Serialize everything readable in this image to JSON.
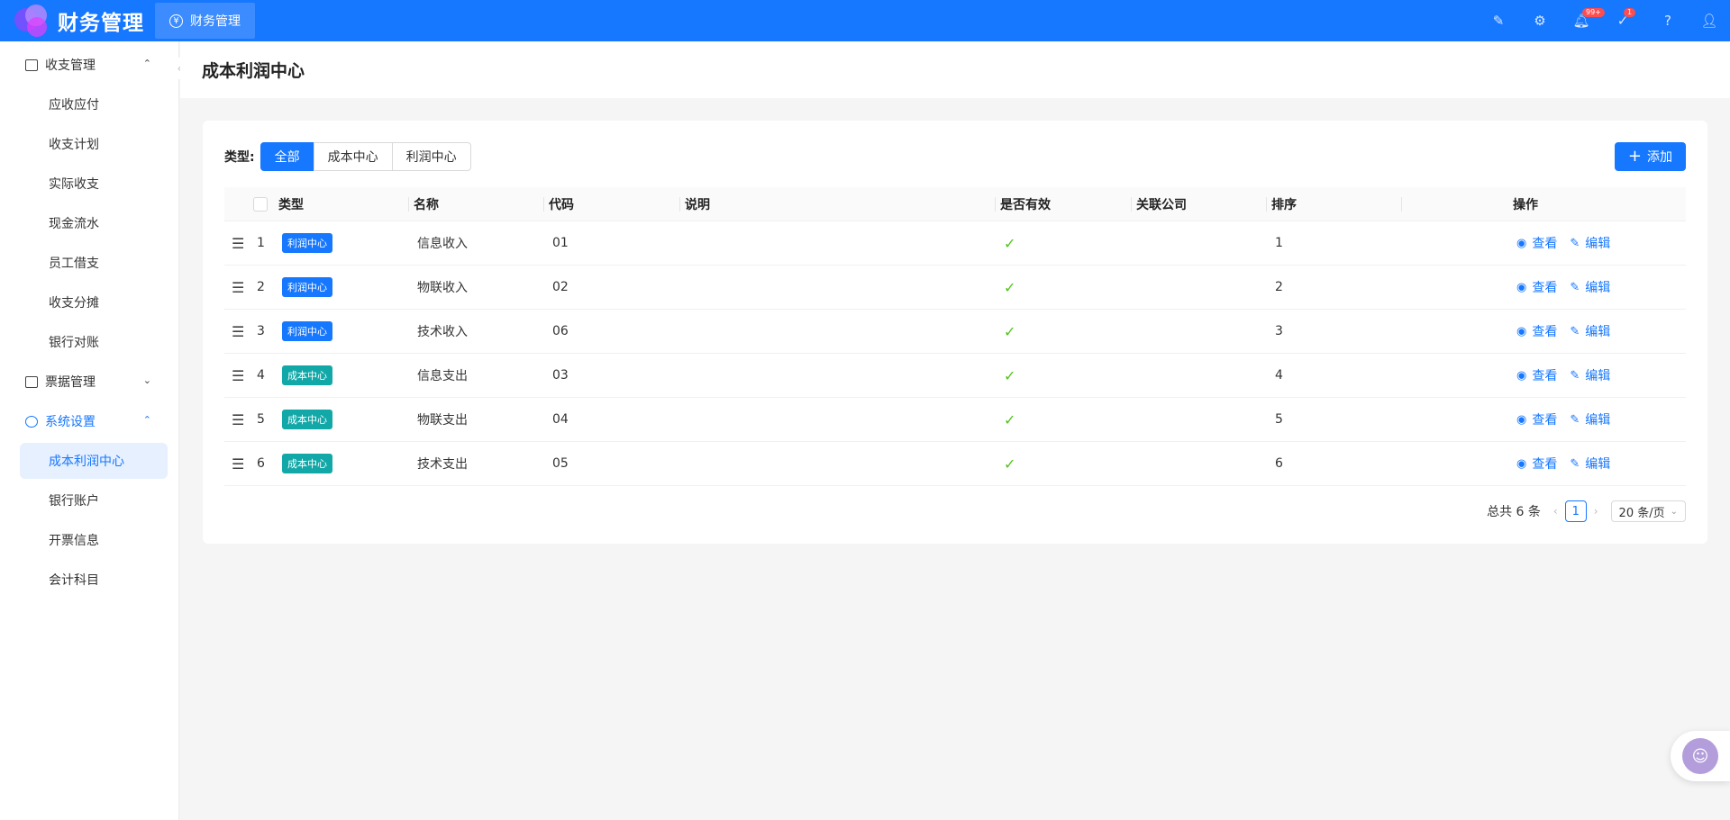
{
  "header": {
    "app_title": "财务管理",
    "module_tab": "财务管理",
    "module_icon": "yen-icon",
    "notification_badge": "99+",
    "task_badge": "1"
  },
  "sidebar": {
    "groups": [
      {
        "label": "收支管理",
        "expanded": true,
        "items": [
          "应收应付",
          "收支计划",
          "实际收支",
          "现金流水",
          "员工借支",
          "收支分摊",
          "银行对账"
        ]
      },
      {
        "label": "票据管理",
        "expanded": false,
        "items": []
      },
      {
        "label": "系统设置",
        "expanded": true,
        "active": true,
        "items": [
          "成本利润中心",
          "银行账户",
          "开票信息",
          "会计科目"
        ]
      }
    ]
  },
  "page": {
    "title": "成本利润中心"
  },
  "filter": {
    "label": "类型:",
    "options": [
      "全部",
      "成本中心",
      "利润中心"
    ],
    "selected": "全部"
  },
  "add_button": "添加",
  "table": {
    "columns": [
      "类型",
      "名称",
      "代码",
      "说明",
      "是否有效",
      "关联公司",
      "排序",
      "操作"
    ],
    "rows": [
      {
        "index": "1",
        "type": "利润中心",
        "name": "信息收入",
        "code": "01",
        "desc": "",
        "valid": true,
        "company": "",
        "sort": "1"
      },
      {
        "index": "2",
        "type": "利润中心",
        "name": "物联收入",
        "code": "02",
        "desc": "",
        "valid": true,
        "company": "",
        "sort": "2"
      },
      {
        "index": "3",
        "type": "利润中心",
        "name": "技术收入",
        "code": "06",
        "desc": "",
        "valid": true,
        "company": "",
        "sort": "3"
      },
      {
        "index": "4",
        "type": "成本中心",
        "name": "信息支出",
        "code": "03",
        "desc": "",
        "valid": true,
        "company": "",
        "sort": "4"
      },
      {
        "index": "5",
        "type": "成本中心",
        "name": "物联支出",
        "code": "04",
        "desc": "",
        "valid": true,
        "company": "",
        "sort": "5"
      },
      {
        "index": "6",
        "type": "成本中心",
        "name": "技术支出",
        "code": "05",
        "desc": "",
        "valid": true,
        "company": "",
        "sort": "6"
      }
    ],
    "actions": {
      "view": "查看",
      "edit": "编辑"
    }
  },
  "pagination": {
    "total": "总共 6 条",
    "current_page": "1",
    "page_size": "20 条/页"
  },
  "colors": {
    "primary": "#1677ff",
    "profit_tag": "#1677ff",
    "cost_tag": "#13a8a8",
    "valid_check": "#52c41a"
  }
}
